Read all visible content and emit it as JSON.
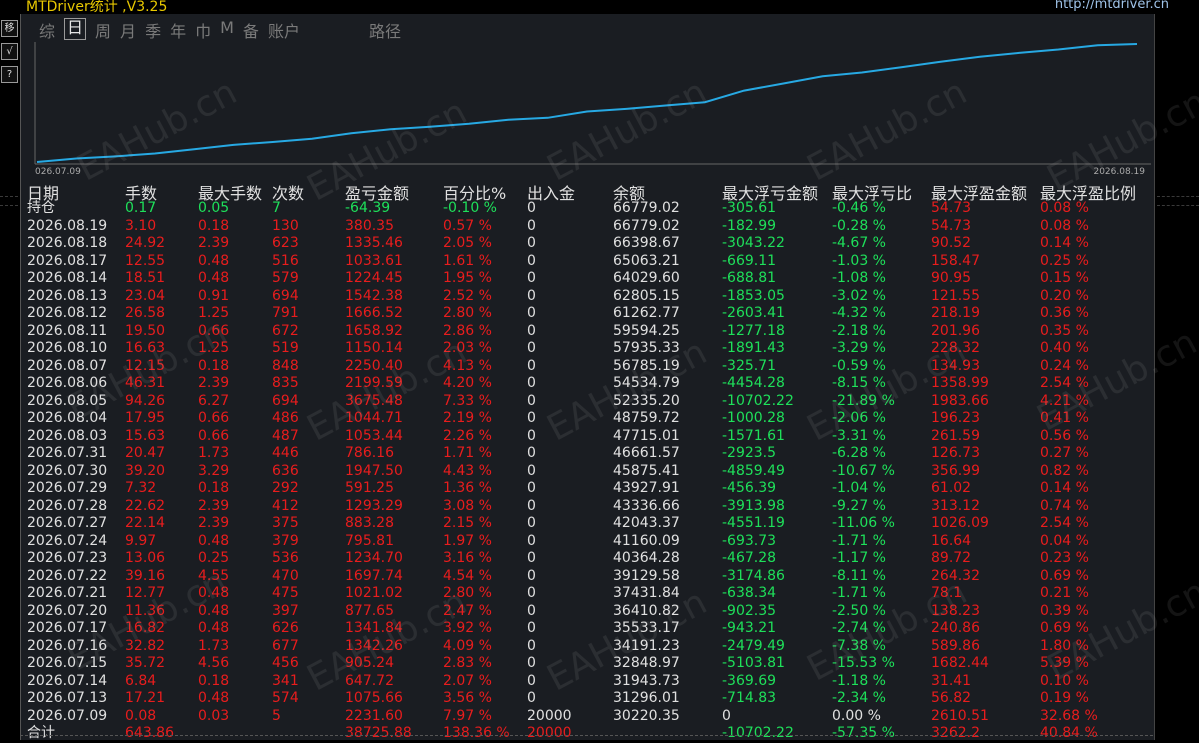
{
  "window": {
    "title": "MTDriver统计 ,V3.25",
    "url": "http://mtdriver.cn"
  },
  "left_toolbar": [
    "移",
    "√",
    "?"
  ],
  "tabs": [
    {
      "label": "综",
      "active": false
    },
    {
      "label": "日",
      "active": true
    },
    {
      "label": "周",
      "active": false
    },
    {
      "label": "月",
      "active": false
    },
    {
      "label": "季",
      "active": false
    },
    {
      "label": "年",
      "active": false
    },
    {
      "label": "巾",
      "active": false
    },
    {
      "label": "M",
      "active": false
    },
    {
      "label": "备",
      "active": false
    },
    {
      "label": "账户",
      "active": false
    },
    {
      "label": "路径",
      "active": false
    }
  ],
  "chart": {
    "start_label": "026.07.09",
    "end_label": "2026.08.19",
    "line_color": "#27a9e3"
  },
  "columns": [
    "日期",
    "手数",
    "最大手数",
    "次数",
    "盈亏金额",
    "百分比%",
    "出入金",
    "余额",
    "最大浮亏金额",
    "最大浮亏比",
    "最大浮盈金额",
    "最大浮盈比例"
  ],
  "rows": [
    [
      "持仓",
      "0.17",
      "0.05",
      "7",
      "-64.39",
      "-0.10 %",
      "0",
      "66779.02",
      "-305.61",
      "-0.46 %",
      "54.73",
      "0.08 %"
    ],
    [
      "2026.08.19",
      "3.10",
      "0.18",
      "130",
      "380.35",
      "0.57 %",
      "0",
      "66779.02",
      "-182.99",
      "-0.28 %",
      "54.73",
      "0.08 %"
    ],
    [
      "2026.08.18",
      "24.92",
      "2.39",
      "623",
      "1335.46",
      "2.05 %",
      "0",
      "66398.67",
      "-3043.22",
      "-4.67 %",
      "90.52",
      "0.14 %"
    ],
    [
      "2026.08.17",
      "12.55",
      "0.48",
      "516",
      "1033.61",
      "1.61 %",
      "0",
      "65063.21",
      "-669.11",
      "-1.03 %",
      "158.47",
      "0.25 %"
    ],
    [
      "2026.08.14",
      "18.51",
      "0.48",
      "579",
      "1224.45",
      "1.95 %",
      "0",
      "64029.60",
      "-688.81",
      "-1.08 %",
      "90.95",
      "0.15 %"
    ],
    [
      "2026.08.13",
      "23.04",
      "0.91",
      "694",
      "1542.38",
      "2.52 %",
      "0",
      "62805.15",
      "-1853.05",
      "-3.02 %",
      "121.55",
      "0.20 %"
    ],
    [
      "2026.08.12",
      "26.58",
      "1.25",
      "791",
      "1666.52",
      "2.80 %",
      "0",
      "61262.77",
      "-2603.41",
      "-4.32 %",
      "218.19",
      "0.36 %"
    ],
    [
      "2026.08.11",
      "19.50",
      "0.66",
      "672",
      "1658.92",
      "2.86 %",
      "0",
      "59594.25",
      "-1277.18",
      "-2.18 %",
      "201.96",
      "0.35 %"
    ],
    [
      "2026.08.10",
      "16.63",
      "1.25",
      "519",
      "1150.14",
      "2.03 %",
      "0",
      "57935.33",
      "-1891.43",
      "-3.29 %",
      "228.32",
      "0.40 %"
    ],
    [
      "2026.08.07",
      "12.15",
      "0.18",
      "848",
      "2250.40",
      "4.13 %",
      "0",
      "56785.19",
      "-325.71",
      "-0.59 %",
      "134.93",
      "0.24 %"
    ],
    [
      "2026.08.06",
      "46.31",
      "2.39",
      "835",
      "2199.59",
      "4.20 %",
      "0",
      "54534.79",
      "-4454.28",
      "-8.15 %",
      "1358.99",
      "2.54 %"
    ],
    [
      "2026.08.05",
      "94.26",
      "6.27",
      "694",
      "3675.48",
      "7.33 %",
      "0",
      "52335.20",
      "-10702.22",
      "-21.89 %",
      "1983.66",
      "4.21 %"
    ],
    [
      "2026.08.04",
      "17.95",
      "0.66",
      "486",
      "1044.71",
      "2.19 %",
      "0",
      "48759.72",
      "-1000.28",
      "-2.06 %",
      "196.23",
      "0.41 %"
    ],
    [
      "2026.08.03",
      "15.63",
      "0.66",
      "487",
      "1053.44",
      "2.26 %",
      "0",
      "47715.01",
      "-1571.61",
      "-3.31 %",
      "261.59",
      "0.56 %"
    ],
    [
      "2026.07.31",
      "20.47",
      "1.73",
      "446",
      "786.16",
      "1.71 %",
      "0",
      "46661.57",
      "-2923.5",
      "-6.28 %",
      "126.73",
      "0.27 %"
    ],
    [
      "2026.07.30",
      "39.20",
      "3.29",
      "636",
      "1947.50",
      "4.43 %",
      "0",
      "45875.41",
      "-4859.49",
      "-10.67 %",
      "356.99",
      "0.82 %"
    ],
    [
      "2026.07.29",
      "7.32",
      "0.18",
      "292",
      "591.25",
      "1.36 %",
      "0",
      "43927.91",
      "-456.39",
      "-1.04 %",
      "61.02",
      "0.14 %"
    ],
    [
      "2026.07.28",
      "22.62",
      "2.39",
      "412",
      "1293.29",
      "3.08 %",
      "0",
      "43336.66",
      "-3913.98",
      "-9.27 %",
      "313.12",
      "0.74 %"
    ],
    [
      "2026.07.27",
      "22.14",
      "2.39",
      "375",
      "883.28",
      "2.15 %",
      "0",
      "42043.37",
      "-4551.19",
      "-11.06 %",
      "1026.09",
      "2.54 %"
    ],
    [
      "2026.07.24",
      "9.97",
      "0.48",
      "379",
      "795.81",
      "1.97 %",
      "0",
      "41160.09",
      "-693.73",
      "-1.71 %",
      "16.64",
      "0.04 %"
    ],
    [
      "2026.07.23",
      "13.06",
      "0.25",
      "536",
      "1234.70",
      "3.16 %",
      "0",
      "40364.28",
      "-467.28",
      "-1.17 %",
      "89.72",
      "0.23 %"
    ],
    [
      "2026.07.22",
      "39.16",
      "4.55",
      "470",
      "1697.74",
      "4.54 %",
      "0",
      "39129.58",
      "-3174.86",
      "-8.11 %",
      "264.32",
      "0.69 %"
    ],
    [
      "2026.07.21",
      "12.77",
      "0.48",
      "475",
      "1021.02",
      "2.80 %",
      "0",
      "37431.84",
      "-638.34",
      "-1.71 %",
      "78.1",
      "0.21 %"
    ],
    [
      "2026.07.20",
      "11.36",
      "0.48",
      "397",
      "877.65",
      "2.47 %",
      "0",
      "36410.82",
      "-902.35",
      "-2.50 %",
      "138.23",
      "0.39 %"
    ],
    [
      "2026.07.17",
      "16.82",
      "0.48",
      "626",
      "1341.84",
      "3.92 %",
      "0",
      "35533.17",
      "-943.21",
      "-2.74 %",
      "240.86",
      "0.69 %"
    ],
    [
      "2026.07.16",
      "32.82",
      "1.73",
      "677",
      "1342.26",
      "4.09 %",
      "0",
      "34191.23",
      "-2479.49",
      "-7.38 %",
      "589.86",
      "1.80 %"
    ],
    [
      "2026.07.15",
      "35.72",
      "4.56",
      "456",
      "905.24",
      "2.83 %",
      "0",
      "32848.97",
      "-5103.81",
      "-15.53 %",
      "1682.44",
      "5.39 %"
    ],
    [
      "2026.07.14",
      "6.84",
      "0.18",
      "341",
      "647.72",
      "2.07 %",
      "0",
      "31943.73",
      "-369.69",
      "-1.18 %",
      "31.41",
      "0.10 %"
    ],
    [
      "2026.07.13",
      "17.21",
      "0.48",
      "574",
      "1075.66",
      "3.56 %",
      "0",
      "31296.01",
      "-714.83",
      "-2.34 %",
      "56.82",
      "0.19 %"
    ],
    [
      "2026.07.09",
      "0.08",
      "0.03",
      "5",
      "2231.60",
      "7.97 %",
      "20000",
      "30220.35",
      "0",
      "0.00 %",
      "2610.51",
      "32.68 %"
    ]
  ],
  "total": [
    "合计",
    "643.86",
    "",
    "",
    "38725.88",
    "138.36 %",
    "20000",
    "",
    "-10702.22",
    "-57.35 %",
    "3262.2",
    "40.84 %"
  ],
  "colors": {
    "positive": "#e81d1d",
    "negative": "#1ee05a",
    "neutral": "#e0e0e0",
    "title": "#e8c800"
  },
  "watermark": "EAHub.cn"
}
